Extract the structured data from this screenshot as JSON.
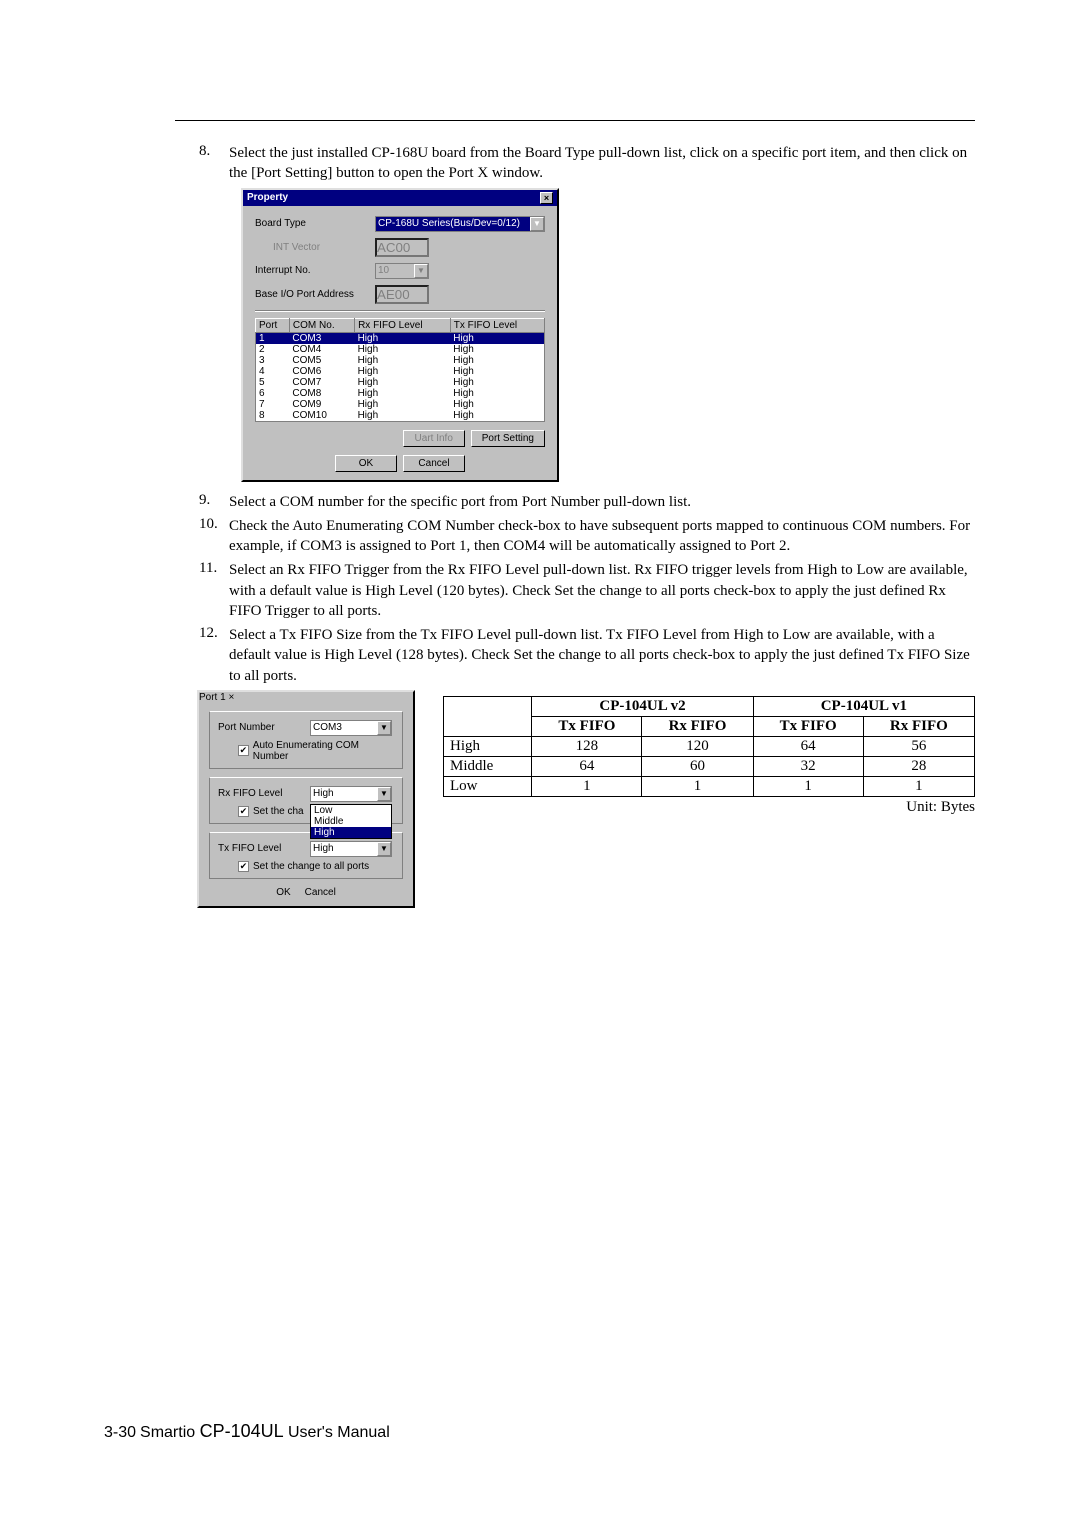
{
  "steps": {
    "s8": {
      "num": "8.",
      "text": "Select the just installed CP-168U board from the Board Type pull-down list, click on a specific port item, and then click on the [Port Setting] button to open the Port X window."
    },
    "s9": {
      "num": "9.",
      "text": "Select a COM number for the specific port from Port Number pull-down list."
    },
    "s10": {
      "num": "10.",
      "text": "Check the Auto Enumerating COM Number check-box to have subsequent ports mapped to continuous COM numbers. For example, if COM3 is assigned to Port 1, then COM4 will be automatically assigned to Port 2."
    },
    "s11": {
      "num": "11.",
      "text": "Select an Rx FIFO Trigger from the Rx FIFO Level pull-down list. Rx FIFO trigger levels from High to Low are available, with a default value is High Level (120 bytes). Check Set the change to all ports check-box to apply the just defined Rx FIFO Trigger to all ports."
    },
    "s12": {
      "num": "12.",
      "text": "Select a Tx FIFO Size from the Tx FIFO Level pull-down list. Tx FIFO Level from High to Low are available, with a default value is High Level (128 bytes).  Check Set the change to all ports check-box to apply the just defined Tx FIFO Size to all ports."
    }
  },
  "property_dialog": {
    "title": "Property",
    "close": "×",
    "board_type_label": "Board Type",
    "board_type_value": "CP-168U Series(Bus/Dev=0/12)",
    "int_vector_label": "INT Vector",
    "int_vector_value": "AC00",
    "interrupt_label": "Interrupt No.",
    "interrupt_value": "10",
    "base_io_label": "Base I/O Port Address",
    "base_io_value": "AE00",
    "th_port": "Port",
    "th_com": "COM No.",
    "th_rx": "Rx FIFO Level",
    "th_tx": "Tx FIFO Level",
    "rows": [
      {
        "p": "1",
        "c": "COM3",
        "rx": "High",
        "tx": "High",
        "sel": true
      },
      {
        "p": "2",
        "c": "COM4",
        "rx": "High",
        "tx": "High"
      },
      {
        "p": "3",
        "c": "COM5",
        "rx": "High",
        "tx": "High"
      },
      {
        "p": "4",
        "c": "COM6",
        "rx": "High",
        "tx": "High"
      },
      {
        "p": "5",
        "c": "COM7",
        "rx": "High",
        "tx": "High"
      },
      {
        "p": "6",
        "c": "COM8",
        "rx": "High",
        "tx": "High"
      },
      {
        "p": "7",
        "c": "COM9",
        "rx": "High",
        "tx": "High"
      },
      {
        "p": "8",
        "c": "COM10",
        "rx": "High",
        "tx": "High"
      }
    ],
    "btn_uart": "Uart Info",
    "btn_port_setting": "Port Setting",
    "btn_ok": "OK",
    "btn_cancel": "Cancel"
  },
  "port_dialog": {
    "title": "Port 1",
    "close": "×",
    "port_number_label": "Port Number",
    "port_number_value": "COM3",
    "auto_enum_label": "Auto Enumerating COM Number",
    "rx_label": "Rx FIFO Level",
    "rx_value": "High",
    "set_change_rx": "Set the cha",
    "dropdown": {
      "low": "Low",
      "middle": "Middle",
      "high": "High"
    },
    "tx_label": "Tx FIFO Level",
    "tx_value": "High",
    "set_change_tx": "Set the change to all ports",
    "btn_ok": "OK",
    "btn_cancel": "Cancel"
  },
  "fifo_table": {
    "h_v2": "CP-104UL v2",
    "h_v1": "CP-104UL v1",
    "h_tx": "Tx FIFO",
    "h_rx": "Rx FIFO",
    "rows": [
      {
        "lvl": "High",
        "v2tx": "128",
        "v2rx": "120",
        "v1tx": "64",
        "v1rx": "56"
      },
      {
        "lvl": "Middle",
        "v2tx": "64",
        "v2rx": "60",
        "v1tx": "32",
        "v1rx": "28"
      },
      {
        "lvl": "Low",
        "v2tx": "1",
        "v2rx": "1",
        "v1tx": "1",
        "v1rx": "1"
      }
    ],
    "unit": "Unit: Bytes"
  },
  "footer": {
    "page": "3-30",
    "sep": "   ",
    "brand": "Smartio ",
    "product": "CP-104UL ",
    "rest": "User's Manual"
  }
}
